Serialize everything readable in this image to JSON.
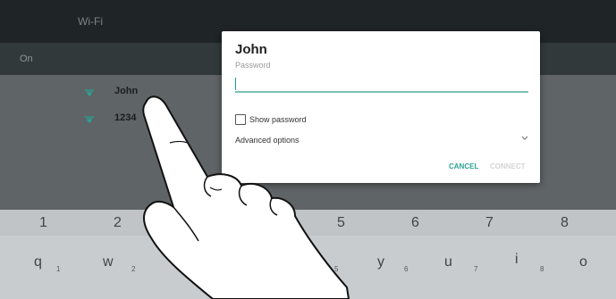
{
  "wifi": {
    "title": "Wi-Fi",
    "status": "On",
    "networks": [
      {
        "ssid": "John",
        "icon": "wifi-signal-icon"
      },
      {
        "ssid": "1234",
        "icon": "wifi-signal-icon"
      }
    ]
  },
  "dialog": {
    "title": "John",
    "password_label": "Password",
    "password_value": "",
    "show_password_label": "Show password",
    "show_password_checked": false,
    "advanced_options_label": "Advanced options",
    "cancel_label": "CANCEL",
    "connect_label": "CONNECT"
  },
  "keyboard": {
    "number_row": [
      "1",
      "2",
      "5",
      "6",
      "7",
      "8"
    ],
    "letter_row": [
      {
        "key": "q",
        "sub": "1"
      },
      {
        "key": "w",
        "sub": "2"
      },
      {
        "key": "t",
        "sub": "5"
      },
      {
        "key": "y",
        "sub": "6"
      },
      {
        "key": "u",
        "sub": "7"
      },
      {
        "key": "i",
        "sub": "8"
      },
      {
        "key": "o",
        "sub": ""
      }
    ]
  },
  "colors": {
    "accent": "#2aa393",
    "dialog_bg": "#ffffff",
    "top_bar": "#1f2427"
  }
}
